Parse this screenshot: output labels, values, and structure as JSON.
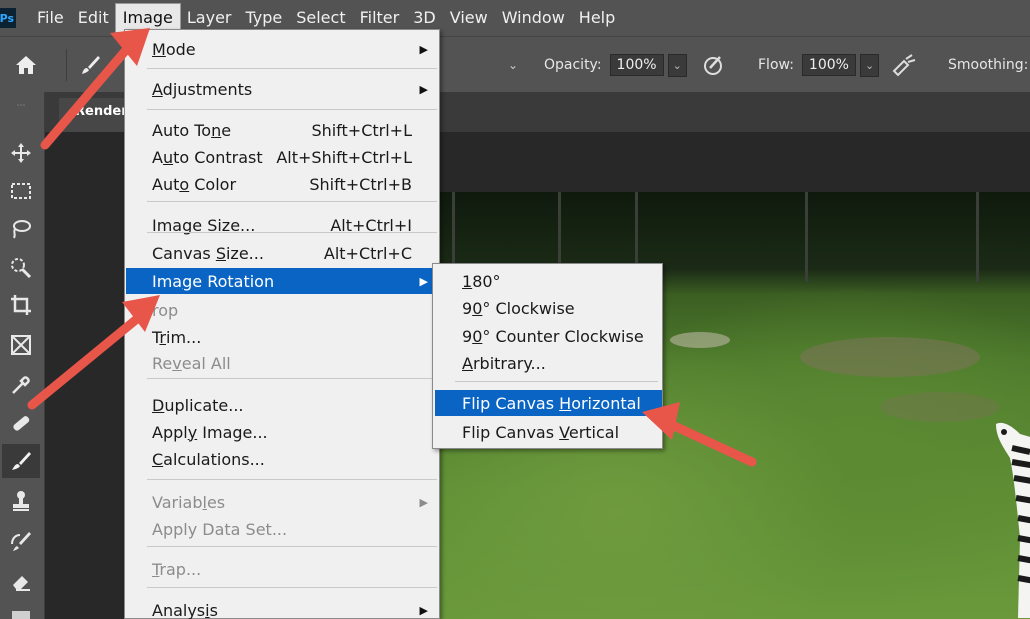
{
  "app": {
    "logo": "Ps"
  },
  "menubar": {
    "items": [
      "File",
      "Edit",
      "Image",
      "Layer",
      "Type",
      "Select",
      "Filter",
      "3D",
      "View",
      "Window",
      "Help"
    ],
    "active": "Image"
  },
  "options_bar": {
    "opacity_label": "Opacity:",
    "opacity_value": "100%",
    "flow_label": "Flow:",
    "flow_value": "100%",
    "smoothing_label": "Smoothing:"
  },
  "document_tab": {
    "title": "Rendero"
  },
  "image_menu": {
    "items": [
      {
        "label": "Mode",
        "submenu": true
      },
      {
        "label": "Adjustments",
        "submenu": true
      },
      {
        "label": "Auto Tone",
        "shortcut": "Shift+Ctrl+L"
      },
      {
        "label": "Auto Contrast",
        "shortcut": "Alt+Shift+Ctrl+L"
      },
      {
        "label": "Auto Color",
        "shortcut": "Shift+Ctrl+B"
      },
      {
        "label": "Image Size...",
        "shortcut": "Alt+Ctrl+I"
      },
      {
        "label": "Canvas Size...",
        "shortcut": "Alt+Ctrl+C"
      },
      {
        "label": "Image Rotation",
        "submenu": true,
        "highlighted": true
      },
      {
        "label": "rop",
        "disabled": true
      },
      {
        "label": "Trim..."
      },
      {
        "label": "Reveal All",
        "disabled": true
      },
      {
        "label": "Duplicate..."
      },
      {
        "label": "Apply Image..."
      },
      {
        "label": "Calculations..."
      },
      {
        "label": "Variables",
        "submenu": true,
        "disabled": true
      },
      {
        "label": "Apply Data Set...",
        "disabled": true
      },
      {
        "label": "Trap...",
        "disabled": true
      },
      {
        "label": "Analysis",
        "submenu": true
      }
    ]
  },
  "rotation_submenu": {
    "items": [
      {
        "label": "180°"
      },
      {
        "label": "90° Clockwise"
      },
      {
        "label": "90° Counter Clockwise"
      },
      {
        "label": "Arbitrary..."
      },
      {
        "label": "Flip Canvas Horizontal",
        "highlighted": true
      },
      {
        "label": "Flip Canvas Vertical"
      }
    ]
  },
  "colors": {
    "highlight": "#0a64c4",
    "annotation_arrow": "#e8564a",
    "menu_bg": "#f0f0f0",
    "ui_bg": "#535353"
  },
  "icons": {
    "home": "home-icon",
    "brush": "brush-icon",
    "move": "move-icon",
    "marquee": "marquee-icon",
    "lasso": "lasso-icon",
    "quick_select": "quick-select-icon",
    "crop": "crop-icon",
    "frame": "frame-icon",
    "eyedropper": "eyedropper-icon",
    "healing": "healing-brush-icon",
    "stamp": "clone-stamp-icon",
    "history_brush": "history-brush-icon",
    "eraser": "eraser-icon",
    "gradient": "gradient-icon",
    "pressure_opacity": "pressure-opacity-icon",
    "airbrush": "airbrush-icon"
  }
}
